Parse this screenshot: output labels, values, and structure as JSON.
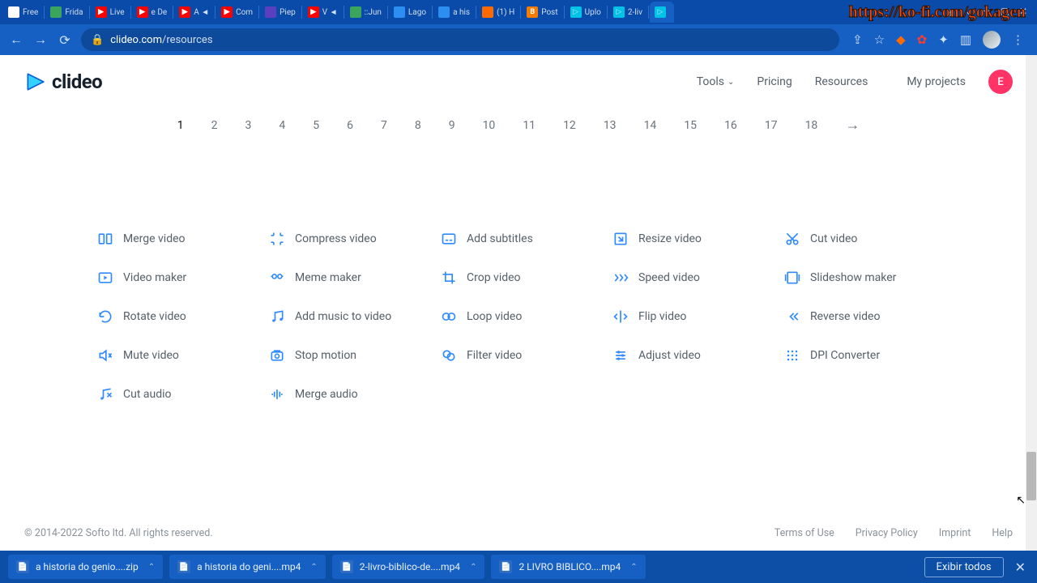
{
  "browser": {
    "tabs": [
      {
        "label": "Free",
        "fav": "fav-wh"
      },
      {
        "label": "Frida",
        "fav": "fav-gr"
      },
      {
        "label": "Live",
        "fav": "fav-yt"
      },
      {
        "label": "e De",
        "fav": "fav-yt"
      },
      {
        "label": "A ◄",
        "fav": "fav-yt"
      },
      {
        "label": "Com",
        "fav": "fav-yt"
      },
      {
        "label": "Piep",
        "fav": "fav-pp"
      },
      {
        "label": "V ◄",
        "fav": "fav-yt"
      },
      {
        "label": "::Jun",
        "fav": "fav-gr"
      },
      {
        "label": "Lago",
        "fav": "fav-bl"
      },
      {
        "label": "a his",
        "fav": "fav-bl"
      },
      {
        "label": "(1) H",
        "fav": "fav-or"
      },
      {
        "label": "Post",
        "fav": "fav-blg"
      },
      {
        "label": "Uplo",
        "fav": "fav-play"
      },
      {
        "label": "2-liv",
        "fav": "fav-play"
      },
      {
        "label": "",
        "fav": "fav-play",
        "active": true
      }
    ],
    "url_host": "clideo.com",
    "url_path": "/resources"
  },
  "watermark": "https://ko-fi.com/gokagen",
  "header": {
    "brand": "clideo",
    "nav": {
      "tools": "Tools",
      "pricing": "Pricing",
      "resources": "Resources",
      "myprojects": "My projects"
    },
    "avatar_letter": "E"
  },
  "pagination": {
    "pages": [
      "1",
      "2",
      "3",
      "4",
      "5",
      "6",
      "7",
      "8",
      "9",
      "10",
      "11",
      "12",
      "13",
      "14",
      "15",
      "16",
      "17",
      "18"
    ],
    "current": "1"
  },
  "tools": [
    {
      "icon": "merge",
      "label": "Merge video"
    },
    {
      "icon": "compress",
      "label": "Compress video"
    },
    {
      "icon": "subtitles",
      "label": "Add subtitles"
    },
    {
      "icon": "resize",
      "label": "Resize video"
    },
    {
      "icon": "cut",
      "label": "Cut video"
    },
    {
      "icon": "maker",
      "label": "Video maker"
    },
    {
      "icon": "meme",
      "label": "Meme maker"
    },
    {
      "icon": "crop",
      "label": "Crop video"
    },
    {
      "icon": "speed",
      "label": "Speed video"
    },
    {
      "icon": "slideshow",
      "label": "Slideshow maker"
    },
    {
      "icon": "rotate",
      "label": "Rotate video"
    },
    {
      "icon": "music",
      "label": "Add music to video"
    },
    {
      "icon": "loop",
      "label": "Loop video"
    },
    {
      "icon": "flip",
      "label": "Flip video"
    },
    {
      "icon": "reverse",
      "label": "Reverse video"
    },
    {
      "icon": "mute",
      "label": "Mute video"
    },
    {
      "icon": "stopmotion",
      "label": "Stop motion"
    },
    {
      "icon": "filter",
      "label": "Filter video"
    },
    {
      "icon": "adjust",
      "label": "Adjust video"
    },
    {
      "icon": "dpi",
      "label": "DPI Converter"
    },
    {
      "icon": "cutaudio",
      "label": "Cut audio"
    },
    {
      "icon": "mergeaudio",
      "label": "Merge audio"
    }
  ],
  "footer": {
    "copyright": "© 2014-2022 Softo ltd. All rights reserved.",
    "links": {
      "terms": "Terms of Use",
      "privacy": "Privacy Policy",
      "imprint": "Imprint",
      "help": "Help"
    }
  },
  "downloads": {
    "items": [
      {
        "name": "a historia do genio....zip"
      },
      {
        "name": "a historia do geni....mp4"
      },
      {
        "name": "2-livro-biblico-de....mp4"
      },
      {
        "name": "2 LIVRO BIBLICO....mp4"
      }
    ],
    "show_all": "Exibir todos"
  }
}
